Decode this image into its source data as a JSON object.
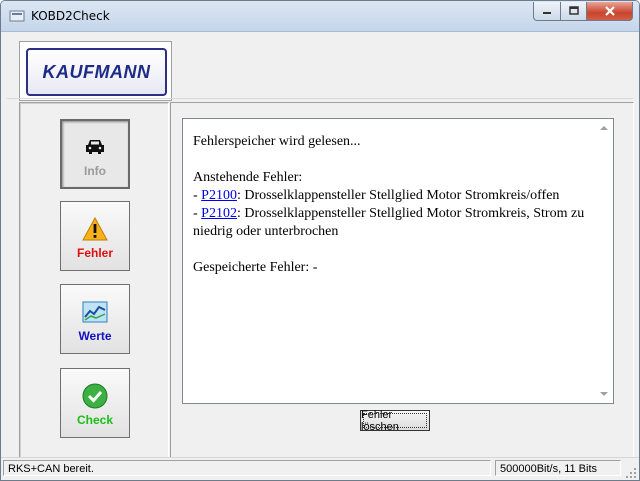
{
  "window": {
    "title": "KOBD2Check"
  },
  "logo": {
    "text": "KAUFMANN"
  },
  "nav": [
    {
      "label": "Info",
      "icon": "car-icon",
      "color": "#9a9a9a"
    },
    {
      "label": "Fehler",
      "icon": "warning-icon",
      "color": "#e01010"
    },
    {
      "label": "Werte",
      "icon": "chart-icon",
      "color": "#1010c0"
    },
    {
      "label": "Check",
      "icon": "check-icon",
      "color": "#18c018"
    }
  ],
  "output": {
    "line1": "Fehlerspeicher wird gelesen...",
    "pending_heading": "Anstehende Fehler:",
    "faults": [
      {
        "prefix": "- ",
        "code": "P2100",
        "desc": ": Drosselklappensteller Stellglied Motor Stromkreis/offen"
      },
      {
        "prefix": "- ",
        "code": "P2102",
        "desc": ": Drosselklappensteller Stellglied Motor Stromkreis, Strom zu niedrig oder unterbrochen"
      }
    ],
    "stored": "Gespeicherte Fehler: -"
  },
  "clear_button": {
    "label": "Fehler löschen"
  },
  "status": {
    "left": "RKS+CAN bereit.",
    "right": "500000Bit/s, 11 Bits"
  }
}
